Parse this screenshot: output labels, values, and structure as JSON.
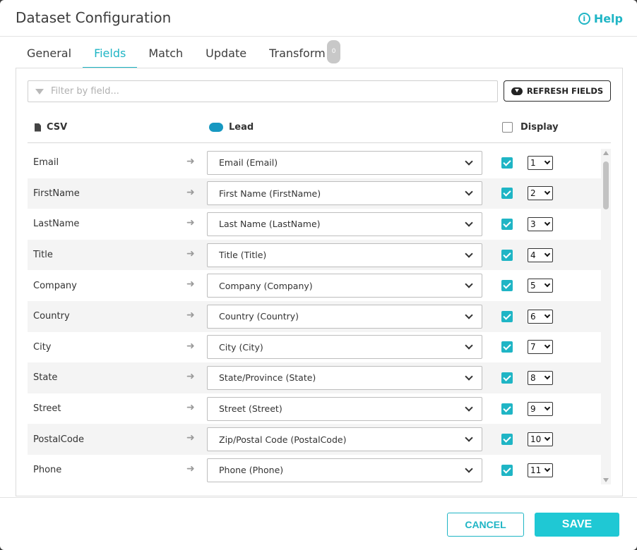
{
  "dialog": {
    "title": "Dataset Configuration",
    "help_label": "Help"
  },
  "tabs": [
    {
      "label": "General"
    },
    {
      "label": "Fields"
    },
    {
      "label": "Match"
    },
    {
      "label": "Update"
    },
    {
      "label": "Transform",
      "badge": "0"
    }
  ],
  "active_tab": "Fields",
  "filter": {
    "placeholder": "Filter by field...",
    "value": ""
  },
  "refresh_label": "REFRESH FIELDS",
  "columns": {
    "source": "CSV",
    "target": "Lead",
    "display": "Display"
  },
  "display_all_checked": false,
  "rows": [
    {
      "source": "Email",
      "target": "Email (Email)",
      "display": true,
      "order": "1"
    },
    {
      "source": "FirstName",
      "target": "First Name (FirstName)",
      "display": true,
      "order": "2"
    },
    {
      "source": "LastName",
      "target": "Last Name (LastName)",
      "display": true,
      "order": "3"
    },
    {
      "source": "Title",
      "target": "Title (Title)",
      "display": true,
      "order": "4"
    },
    {
      "source": "Company",
      "target": "Company (Company)",
      "display": true,
      "order": "5"
    },
    {
      "source": "Country",
      "target": "Country (Country)",
      "display": true,
      "order": "6"
    },
    {
      "source": "City",
      "target": "City (City)",
      "display": true,
      "order": "7"
    },
    {
      "source": "State",
      "target": "State/Province (State)",
      "display": true,
      "order": "8"
    },
    {
      "source": "Street",
      "target": "Street (Street)",
      "display": true,
      "order": "9"
    },
    {
      "source": "PostalCode",
      "target": "Zip/Postal Code (PostalCode)",
      "display": true,
      "order": "10"
    },
    {
      "source": "Phone",
      "target": "Phone (Phone)",
      "display": true,
      "order": "11"
    }
  ],
  "footer": {
    "cancel_label": "CANCEL",
    "save_label": "SAVE"
  },
  "colors": {
    "accent": "#1fb5c5",
    "save_bg": "#1fc8d4",
    "salesforce": "#1798c1"
  },
  "icons": {
    "help": "info-circle-icon",
    "filter": "filter-funnel-icon",
    "refresh": "cloud-download-icon",
    "csv": "file-icon",
    "lead": "salesforce-cloud-icon",
    "row_arrow": "arrow-right-icon",
    "select": "chevron-down-icon",
    "display": "checkbox-icon"
  }
}
